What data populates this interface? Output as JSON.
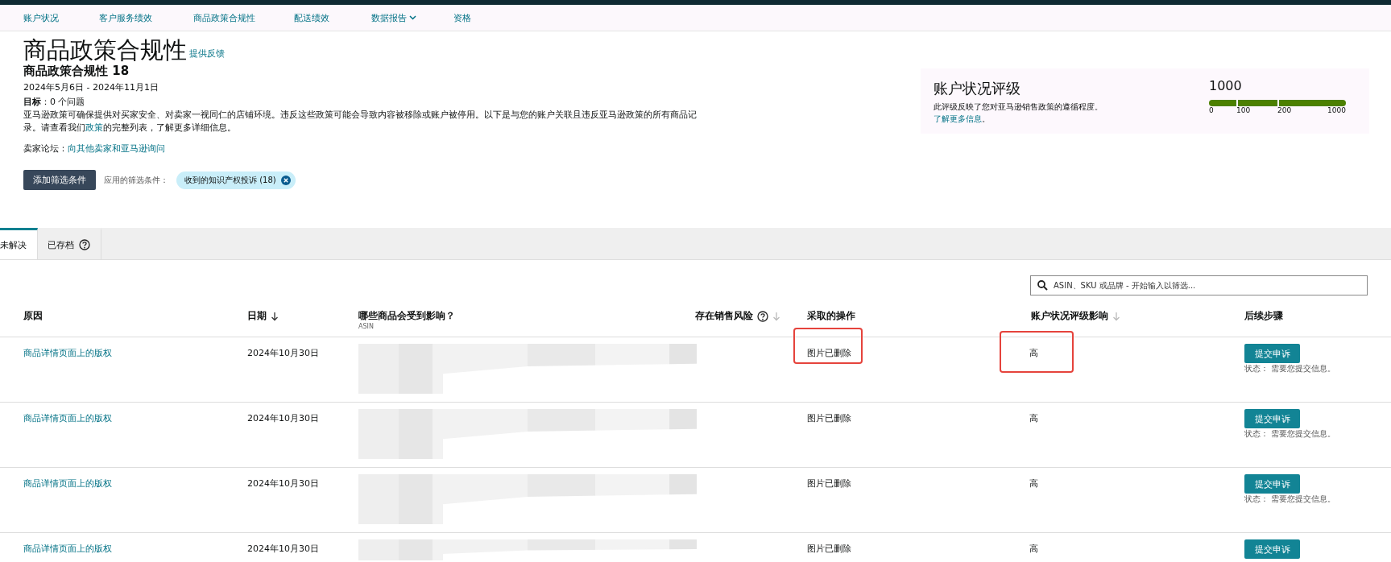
{
  "nav": [
    {
      "label": "账户状况",
      "dropdown": false
    },
    {
      "label": "客户服务绩效",
      "dropdown": false
    },
    {
      "label": "商品政策合规性",
      "dropdown": false
    },
    {
      "label": "配送绩效",
      "dropdown": false
    },
    {
      "label": "数据报告",
      "dropdown": true
    },
    {
      "label": "资格",
      "dropdown": false
    }
  ],
  "header": {
    "title": "商品政策合规性",
    "feedback_link": "提供反馈",
    "subtitle": "商品政策合规性 18",
    "date_range": "2024年5月6日 - 2024年11月1日",
    "goal": "**目标**：0 个问题",
    "description_before": "亚马逊政策可确保提供对买家安全、对卖家一视同仁的店铺环境。违反这些政策可能会导致内容被移除或账户被停用。以下是与您的账户关联且违反亚马逊政策的所有商品记录。请查看我们",
    "description_link": "政策",
    "description_after": "的完整列表，了解更多详细信息。",
    "forum_label": "卖家论坛：",
    "forum_link": "向其他卖家和亚马逊询问"
  },
  "rating_card": {
    "title": "账户状况评级",
    "text": "此评级反映了您对亚马逊销售政策的遵循程度。",
    "link": "了解更多信息",
    "link_suffix": "。",
    "score": "1000",
    "level": 1,
    "ticks": [
      "0",
      "100",
      "200",
      "1000"
    ]
  },
  "filters": {
    "button": "添加筛选条件",
    "label": "应用的筛选条件：",
    "chips": [
      {
        "label": "收到的知识产权投诉 (18)"
      }
    ]
  },
  "tabs": [
    {
      "label": "未解决",
      "selected": true,
      "help": false
    },
    {
      "label": "已存档",
      "selected": false,
      "help": true
    }
  ],
  "search": {
    "placeholder": "ASIN、SKU 或品牌 - 开始输入以筛选..."
  },
  "table": {
    "columns": [
      {
        "label": "原因",
        "sortable": false,
        "help": false
      },
      {
        "label": "日期",
        "sortable": true,
        "sorted": true,
        "help": false
      },
      {
        "label": "哪些商品会受到影响？",
        "sublabel": "ASIN",
        "sortable": false,
        "help": false
      },
      {
        "label": "存在销售风险",
        "sortable": true,
        "sorted": false,
        "help": true
      },
      {
        "label": "采取的操作",
        "sortable": false,
        "help": false
      },
      {
        "label": "账户状况评级影响",
        "sortable": true,
        "sorted": false,
        "help": false
      },
      {
        "label": "后续步骤",
        "sortable": false,
        "help": false
      }
    ],
    "rows": [
      {
        "reason": "商品详情页面上的版权",
        "date": "2024年10月30日",
        "action": "图片已删除",
        "impact": "高",
        "button": "提交申诉",
        "status_label": "状态：",
        "status": "需要您提交信息。",
        "highlighted": true
      },
      {
        "reason": "商品详情页面上的版权",
        "date": "2024年10月30日",
        "action": "图片已删除",
        "impact": "高",
        "button": "提交申诉",
        "status_label": "状态：",
        "status": "需要您提交信息。",
        "highlighted": false
      },
      {
        "reason": "商品详情页面上的版权",
        "date": "2024年10月30日",
        "action": "图片已删除",
        "impact": "高",
        "button": "提交申诉",
        "status_label": "状态：",
        "status": "需要您提交信息。",
        "highlighted": false
      },
      {
        "reason": "商品详情页面上的版权",
        "date": "2024年10月30日",
        "action": "图片已删除",
        "impact": "高",
        "button": "提交申诉",
        "highlighted": false
      }
    ]
  }
}
